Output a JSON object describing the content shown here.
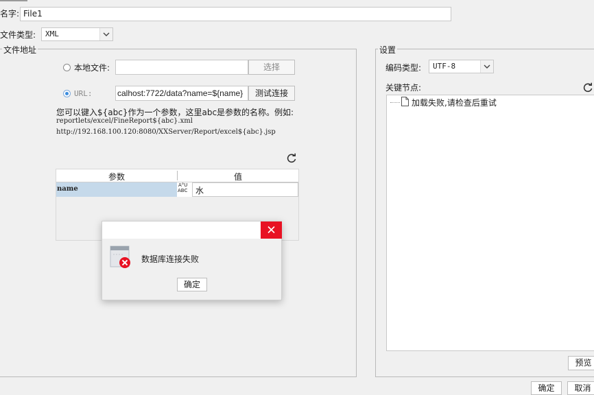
{
  "form": {
    "name_label": "名字:",
    "name_value": "File1",
    "file_type_label": "文件类型:",
    "file_type_value": "XML",
    "file_address_legend": "文件地址",
    "local_file_label": "本地文件:",
    "local_file_value": "",
    "select_button": "选择",
    "url_label": "URL:",
    "url_value": "calhost:7722/data?name=${name}",
    "test_connection_button": "测试连接",
    "hint_line1": "您可以键入${abc}作为一个参数，这里abc是参数的名称。例如:",
    "hint_line2": "reportlets/excel/FineReport${abc}.xml",
    "hint_line3": "http://192.168.100.120:8080/XXServer/Report/excel${abc}.jsp",
    "param_table": {
      "headers": [
        "参数",
        "值"
      ],
      "rows": [
        {
          "name": "name",
          "type_badge_top": "A°U",
          "type_badge_bottom": "ABC",
          "value": "水"
        }
      ]
    }
  },
  "settings": {
    "legend": "设置",
    "encoding_label": "编码类型:",
    "encoding_value": "UTF-8",
    "key_node_label": "关键节点:",
    "tree_item": "加载失败,请检查后重试",
    "preview_button": "预览"
  },
  "dialog": {
    "message": "数据库连接失败",
    "ok_button": "确定"
  },
  "footer": {
    "ok_button": "确定",
    "cancel_button": "取消"
  },
  "colors": {
    "close_button": "#e81123",
    "error_badge": "#e81123",
    "param_row_selected": "#c5d9ea",
    "radio_selected": "#3c8dde"
  }
}
